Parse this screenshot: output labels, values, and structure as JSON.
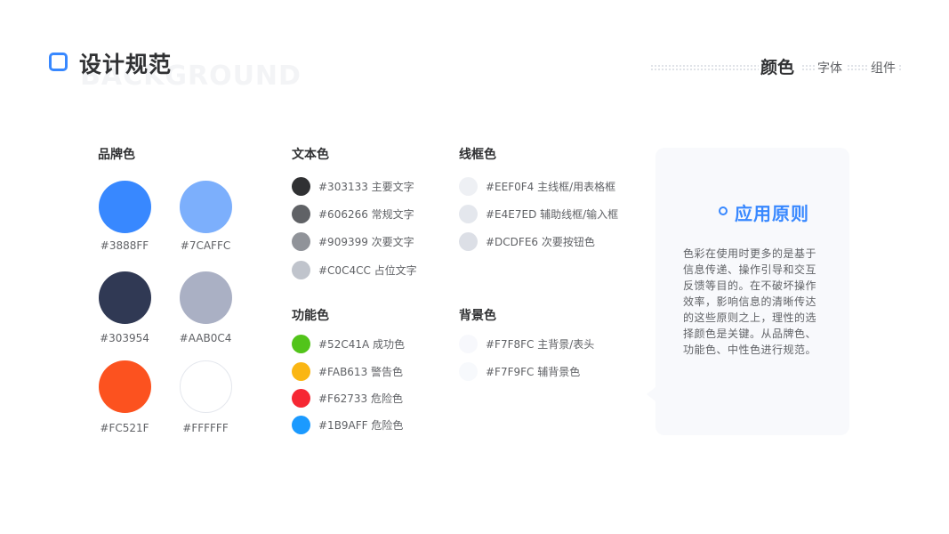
{
  "header": {
    "title": "设计规范",
    "watermark": "BACKGROUND",
    "nav": [
      {
        "label": "颜色",
        "active": true
      },
      {
        "label": "字体",
        "active": false
      },
      {
        "label": "组件",
        "active": false
      }
    ]
  },
  "brand": {
    "title": "品牌色",
    "swatches": [
      {
        "hex": "#3888FF",
        "label": "#3888FF"
      },
      {
        "hex": "#7CAFFC",
        "label": "#7CAFFC"
      },
      {
        "hex": "#303954",
        "label": "#303954"
      },
      {
        "hex": "#AAB0C4",
        "label": "#AAB0C4"
      },
      {
        "hex": "#FC521F",
        "label": "#FC521F"
      },
      {
        "hex": "#FFFFFF",
        "label": "#FFFFFF"
      }
    ]
  },
  "text_colors": {
    "title": "文本色",
    "items": [
      {
        "hex": "#303133",
        "label": "#303133 主要文字"
      },
      {
        "hex": "#606266",
        "label": "#606266 常规文字"
      },
      {
        "hex": "#909399",
        "label": "#909399 次要文字"
      },
      {
        "hex": "#C0C4CC",
        "label": "#C0C4CC 占位文字"
      }
    ]
  },
  "functional_colors": {
    "title": "功能色",
    "items": [
      {
        "hex": "#52C41A",
        "label": "#52C41A 成功色"
      },
      {
        "hex": "#FAB613",
        "label": "#FAB613 警告色"
      },
      {
        "hex": "#F62733",
        "label": "#F62733 危险色"
      },
      {
        "hex": "#1B9AFF",
        "label": "#1B9AFF 危险色"
      }
    ]
  },
  "border_colors": {
    "title": "线框色",
    "items": [
      {
        "hex": "#EEF0F4",
        "label": "#EEF0F4 主线框/用表格框"
      },
      {
        "hex": "#E4E7ED",
        "label": "#E4E7ED 辅助线框/输入框"
      },
      {
        "hex": "#DCDFE6",
        "label": "#DCDFE6 次要按钮色"
      }
    ]
  },
  "background_colors": {
    "title": "背景色",
    "items": [
      {
        "hex": "#F7F8FC",
        "label": "#F7F8FC 主背景/表头"
      },
      {
        "hex": "#F7F9FC",
        "label": "#F7F9FC 辅背景色"
      }
    ]
  },
  "principle": {
    "title": "应用原则",
    "body": "色彩在使用时更多的是基于信息传递、操作引导和交互反馈等目的。在不破坏操作效率，影响信息的清晰传达的这些原则之上，理性的选择颜色是关键。从品牌色、功能色、中性色进行规范。"
  },
  "colors": {
    "accent": "#3888FF",
    "card_bg": "#F8F9FC"
  }
}
